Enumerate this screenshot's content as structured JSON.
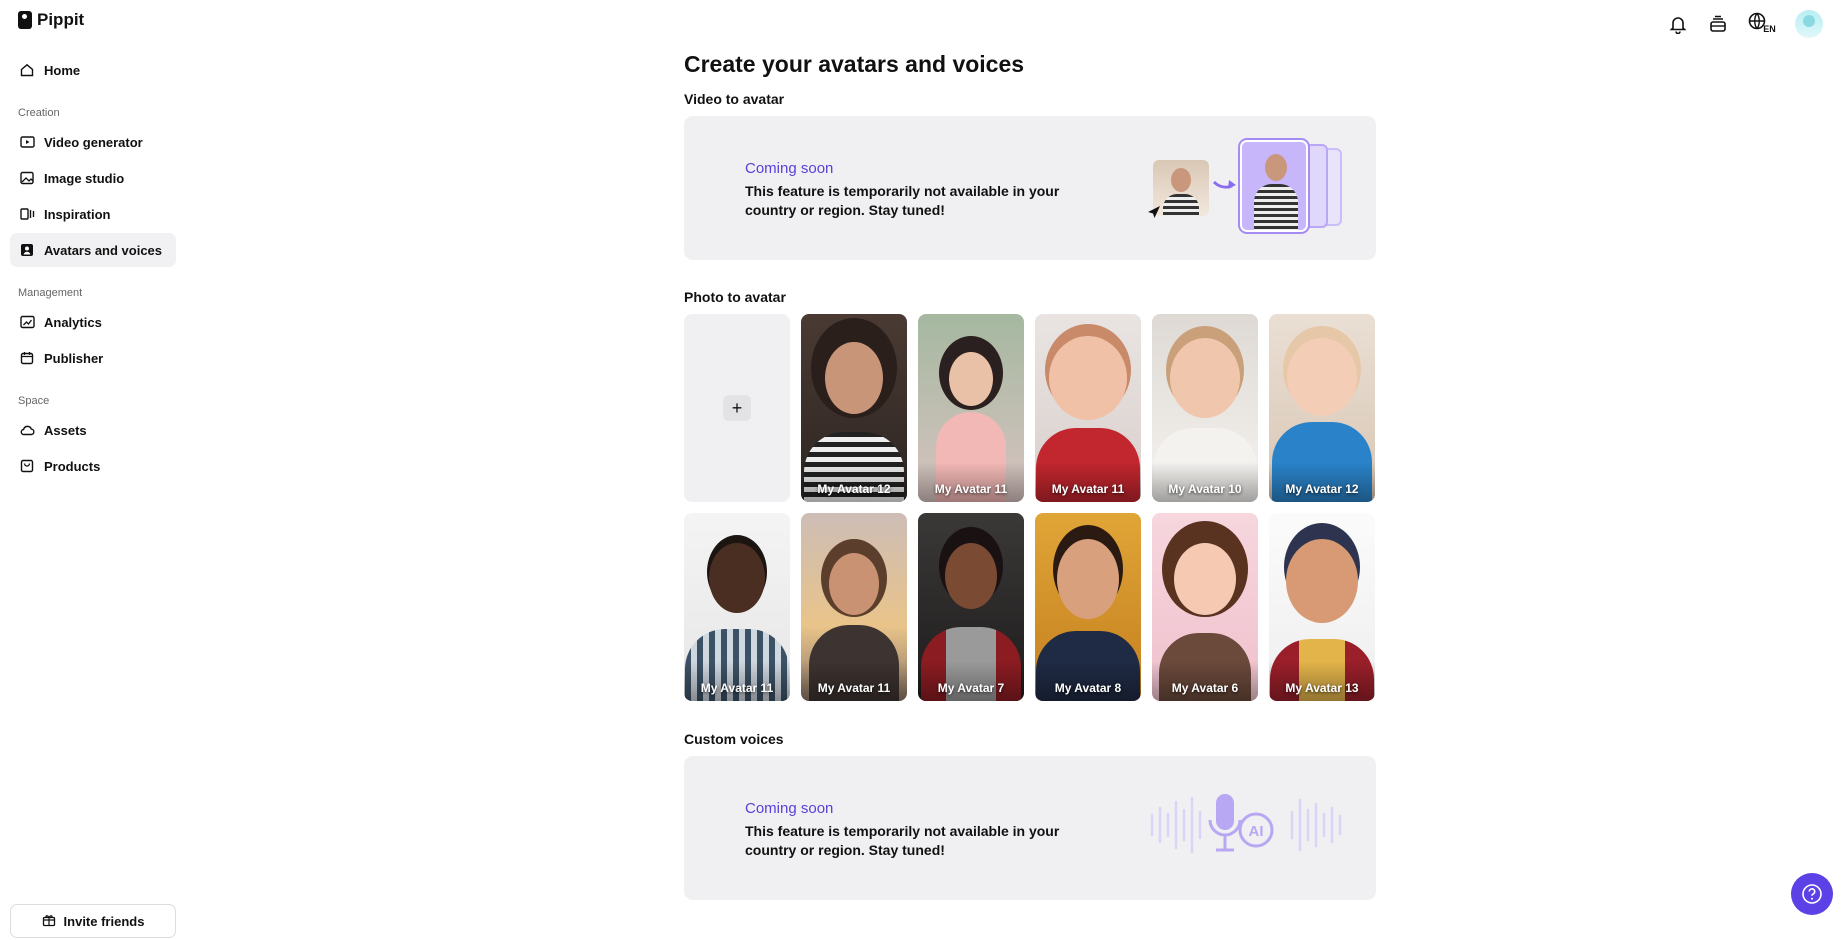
{
  "app": {
    "name": "Pippit"
  },
  "sidebar": {
    "home": "Home",
    "sections": [
      {
        "label": "Creation",
        "items": [
          "Video generator",
          "Image studio",
          "Inspiration",
          "Avatars and voices"
        ]
      },
      {
        "label": "Management",
        "items": [
          "Analytics",
          "Publisher"
        ]
      },
      {
        "label": "Space",
        "items": [
          "Assets",
          "Products"
        ]
      }
    ],
    "active_item": "Avatars and voices",
    "invite": "Invite friends"
  },
  "header": {
    "language": "EN"
  },
  "main": {
    "title": "Create your avatars and voices",
    "video_to_avatar": {
      "heading": "Video to avatar",
      "status": "Coming soon",
      "message": "This feature is temporarily not available in your country or region. Stay tuned!"
    },
    "photo_to_avatar": {
      "heading": "Photo to avatar",
      "add_label": "+",
      "avatars": [
        {
          "name": "My Avatar 12"
        },
        {
          "name": "My Avatar 11"
        },
        {
          "name": "My Avatar 11"
        },
        {
          "name": "My Avatar 10"
        },
        {
          "name": "My Avatar 12"
        },
        {
          "name": "My Avatar 11"
        },
        {
          "name": "My Avatar 11"
        },
        {
          "name": "My Avatar 7"
        },
        {
          "name": "My Avatar 8"
        },
        {
          "name": "My Avatar 6"
        },
        {
          "name": "My Avatar 13"
        }
      ]
    },
    "custom_voices": {
      "heading": "Custom voices",
      "status": "Coming soon",
      "message": "This feature is temporarily not available in your country or region. Stay tuned!"
    }
  },
  "colors": {
    "accent": "#5b41e6",
    "card_bg": "#f0f0f2"
  }
}
